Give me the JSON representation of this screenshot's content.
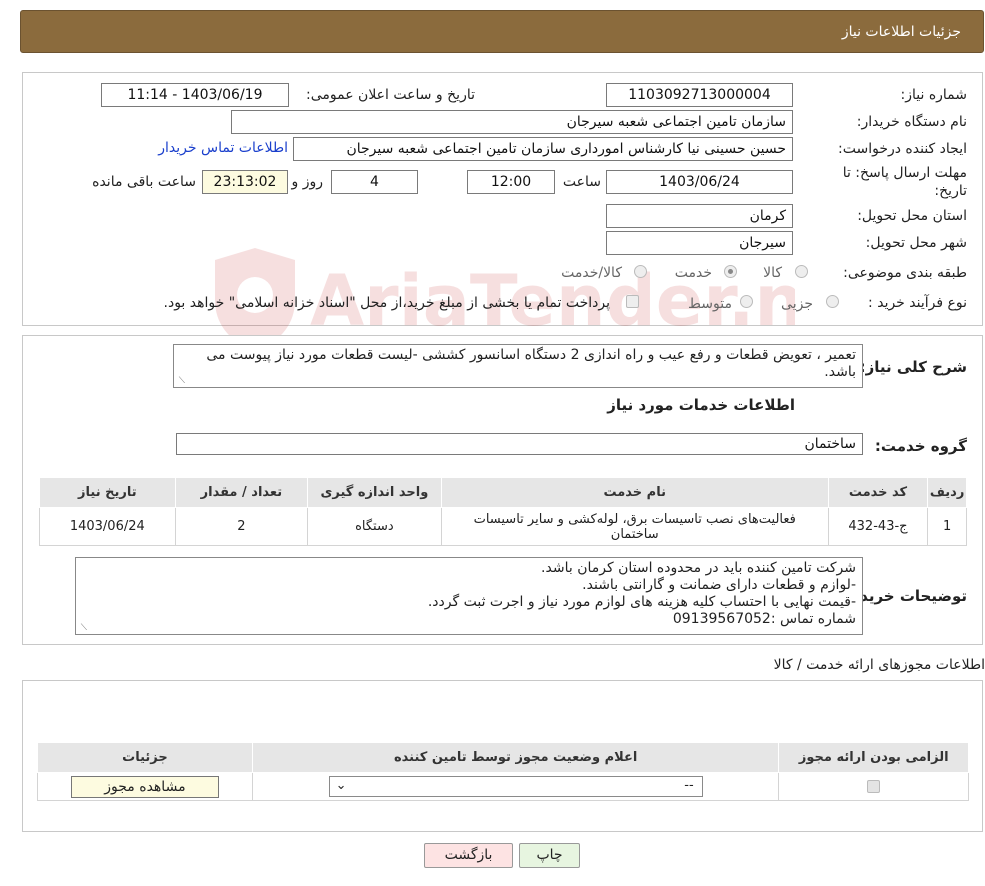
{
  "header": {
    "title": "جزئیات اطلاعات نیاز"
  },
  "details": {
    "need_number_label": "شماره نیاز:",
    "need_number": "1103092713000004",
    "announce_label": "تاریخ و ساعت اعلان عمومی:",
    "announce_value": "1403/06/19 - 11:14",
    "buyer_org_label": "نام دستگاه خریدار:",
    "buyer_org": "سازمان تامین اجتماعی شعبه سیرجان",
    "creator_label": "ایجاد کننده درخواست:",
    "creator": "حسین حسینی نیا کارشناس امورداری سازمان تامین اجتماعی شعبه سیرجان",
    "contact_link": "اطلاعات تماس خریدار",
    "deadline_label_1": "مهلت ارسال پاسخ: تا",
    "deadline_label_2": "تاریخ:",
    "deadline_date": "1403/06/24",
    "time_label": "ساعت",
    "deadline_time": "12:00",
    "days": "4",
    "days_label": "روز و",
    "remaining_time": "23:13:02",
    "remaining_label": "ساعت باقی مانده",
    "province_label": "استان محل تحویل:",
    "province": "کرمان",
    "city_label": "شهر محل تحویل:",
    "city": "سیرجان",
    "category_label": "طبقه بندی موضوعی:",
    "category_options": [
      "کالا",
      "خدمت",
      "کالا/خدمت"
    ],
    "category_selected": "خدمت",
    "process_label": "نوع فرآیند خرید :",
    "process_options": [
      "جزیی",
      "متوسط"
    ],
    "process_selected": "",
    "payment_note": "پرداخت تمام یا بخشی از مبلغ خرید،از محل \"اسناد خزانه اسلامی\" خواهد بود."
  },
  "summary": {
    "label": "شرح کلی نیاز:",
    "text": "تعمیر ، تعویض قطعات و رفع عیب و راه اندازی 2 دستگاه اسانسور کششی -لیست قطعات مورد نیاز پیوست می باشد."
  },
  "services": {
    "section_title": "اطلاعات خدمات مورد نیاز",
    "group_label": "گروه خدمت:",
    "group_value": "ساختمان",
    "columns": [
      "ردیف",
      "کد خدمت",
      "نام خدمت",
      "واحد اندازه گیری",
      "تعداد / مقدار",
      "تاریخ نیاز"
    ],
    "rows": [
      {
        "index": "1",
        "code": "ج-43-432",
        "name": "فعالیت‌های نصب تاسیسات برق، لوله‌کشی و سایر تاسیسات ساختمان",
        "unit": "دستگاه",
        "qty": "2",
        "date": "1403/06/24"
      }
    ]
  },
  "buyer_notes": {
    "label": "توضیحات خریدار:",
    "lines": [
      "شرکت تامین کننده باید در محدوده استان کرمان باشد.",
      "-لوازم و قطعات دارای ضمانت و گارانتی باشند.",
      "-قیمت نهایی با احتساب کلیه هزینه های لوازم مورد نیاز و اجرت ثبت گردد.",
      "شماره تماس :09139567052"
    ]
  },
  "permits": {
    "section_title": "اطلاعات مجوزهای ارائه خدمت / کالا",
    "columns": [
      "الزامی بودن ارائه مجوز",
      "اعلام وضعیت مجوز توسط تامین کننده",
      "جزئیات"
    ],
    "select_value": "--",
    "view_button": "مشاهده مجوز"
  },
  "footer": {
    "print_button": "چاپ",
    "back_button": "بازگشت"
  },
  "watermark": {
    "text": "AriaTender.neT"
  },
  "colors": {
    "header_bg": "#8b6b3d",
    "link": "#1a3fcc",
    "back_button_bg": "#fde3e3",
    "print_button_bg": "#e7f5e0",
    "remaining_bg": "#fdfbe0"
  }
}
